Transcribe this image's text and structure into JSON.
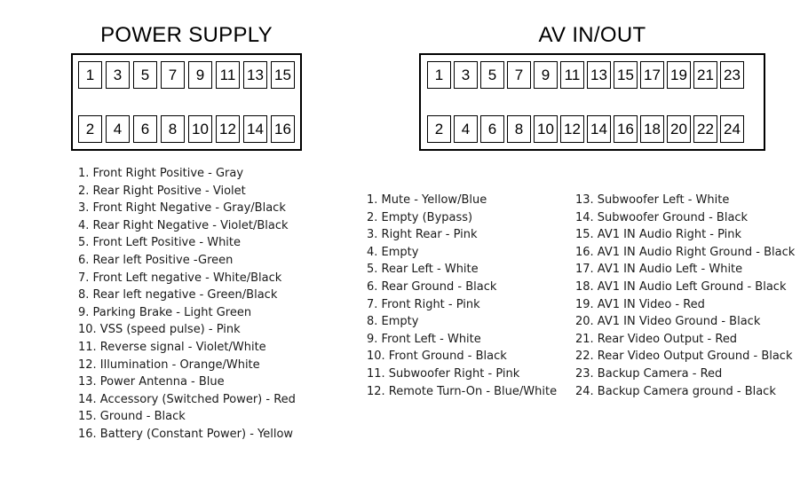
{
  "power_supply": {
    "title": "POWER SUPPLY",
    "connector": {
      "top_row_pins": [
        "1",
        "3",
        "5",
        "7",
        "9",
        "11",
        "13",
        "15"
      ],
      "bottom_row_pins": [
        "2",
        "4",
        "6",
        "8",
        "10",
        "12",
        "14",
        "16"
      ]
    },
    "pins": [
      "1. Front Right Positive -  Gray",
      "2. Rear Right Positive -  Violet",
      "3. Front Right Negative -  Gray/Black",
      "4. Rear Right Negative -  Violet/Black",
      "5. Front Left Positive -  White",
      "6. Rear left Positive -Green",
      "7. Front Left negative -  White/Black",
      "8. Rear left negative -  Green/Black",
      "9. Parking Brake -  Light Green",
      "10. VSS (speed pulse) - Pink",
      "11. Reverse signal -  Violet/White",
      "12. Illumination -  Orange/White",
      "13. Power Antenna -  Blue",
      "14. Accessory (Switched Power) -  Red",
      "15. Ground -  Black",
      "16. Battery (Constant Power) -  Yellow"
    ]
  },
  "av_in_out": {
    "title": "AV IN/OUT",
    "connector": {
      "top_row_pins": [
        "1",
        "3",
        "5",
        "7",
        "9",
        "11",
        "13",
        "15",
        "17",
        "19",
        "21",
        "23"
      ],
      "bottom_row_pins": [
        "2",
        "4",
        "6",
        "8",
        "10",
        "12",
        "14",
        "16",
        "18",
        "20",
        "22",
        "24"
      ]
    },
    "pins_column_1": [
      "1. Mute - Yellow/Blue",
      "2. Empty (Bypass)",
      "3. Right Rear - Pink",
      "4. Empty",
      "5. Rear Left - White",
      "6. Rear Ground - Black",
      "7. Front Right - Pink",
      "8. Empty",
      "9. Front Left - White",
      "10. Front Ground - Black",
      "11. Subwoofer Right - Pink",
      "12. Remote Turn-On - Blue/White"
    ],
    "pins_column_2": [
      "13. Subwoofer Left - White",
      "14. Subwoofer Ground - Black",
      "15. AV1 IN Audio Right - Pink",
      "16. AV1 IN Audio Right Ground - Black",
      "17. AV1 IN Audio Left - White",
      "18. AV1 IN Audio Left Ground - Black",
      "19. AV1 IN Video - Red",
      "20. AV1 IN Video Ground - Black",
      "21. Rear Video Output - Red",
      "22. Rear Video Output Ground - Black",
      "23. Backup Camera - Red",
      "24. Backup Camera ground - Black"
    ]
  },
  "colors": {
    "background": "#ffffff",
    "stroke": "#000000",
    "text": "#1a1a1a"
  }
}
